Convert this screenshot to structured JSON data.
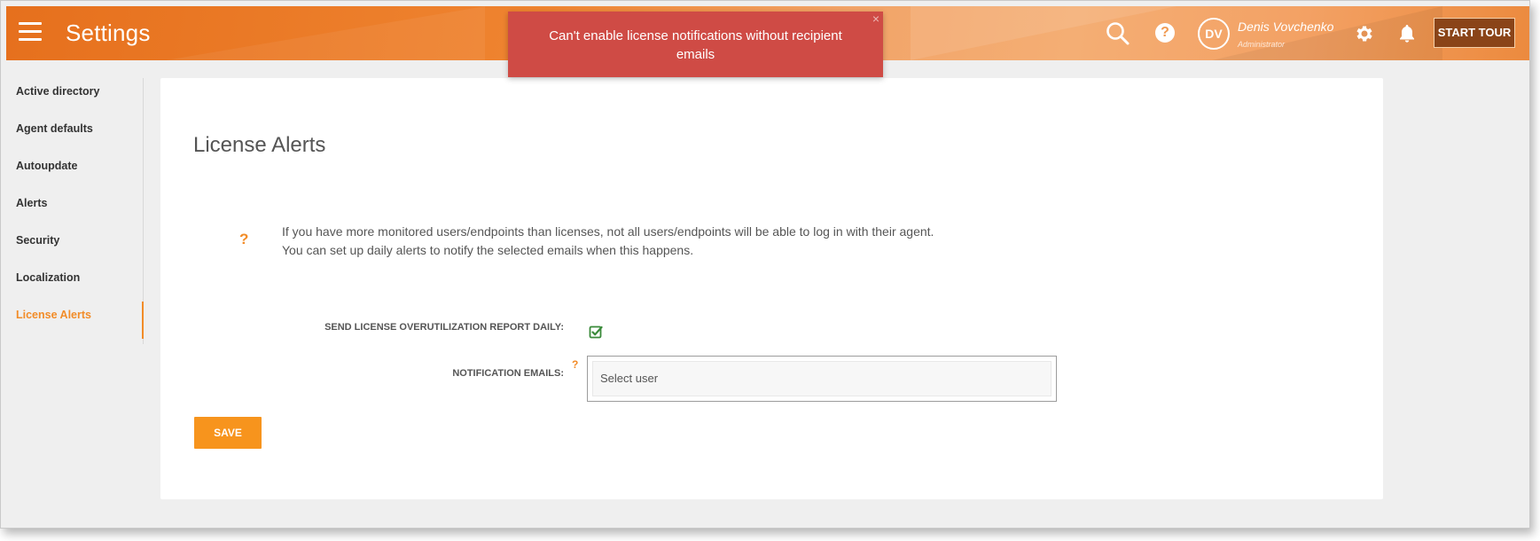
{
  "header": {
    "title": "Settings",
    "user": {
      "initials": "DV",
      "name": "Denis Vovchenko",
      "role": "Administrator"
    },
    "start_tour_label": "START TOUR",
    "help_glyph": "?",
    "icons": [
      "menu-icon",
      "search-icon",
      "help-icon",
      "gear-icon",
      "bell-icon"
    ]
  },
  "toast": {
    "message": "Can't enable license notifications without recipient emails",
    "close_glyph": "×"
  },
  "sidebar": {
    "items": [
      {
        "label": "Active directory"
      },
      {
        "label": "Agent defaults"
      },
      {
        "label": "Autoupdate"
      },
      {
        "label": "Alerts"
      },
      {
        "label": "Security"
      },
      {
        "label": "Localization"
      },
      {
        "label": "License Alerts",
        "active": true
      }
    ]
  },
  "main": {
    "page_title": "License Alerts",
    "info_glyph": "?",
    "info_text": "If you have more monitored users/endpoints than licenses, not all users/endpoints will be able to log in with their agent. You can set up daily alerts to notify the selected emails when this happens.",
    "report_label": "SEND LICENSE OVERUTILIZATION REPORT DAILY:",
    "report_checked": true,
    "emails_label": "NOTIFICATION EMAILS:",
    "emails_help_glyph": "?",
    "emails_placeholder": "Select user",
    "save_label": "SAVE"
  },
  "colors": {
    "accent": "#f28c28",
    "toast": "#cf4b45",
    "start_tour_bg": "#8a4418",
    "check": "#3a8a3a"
  }
}
